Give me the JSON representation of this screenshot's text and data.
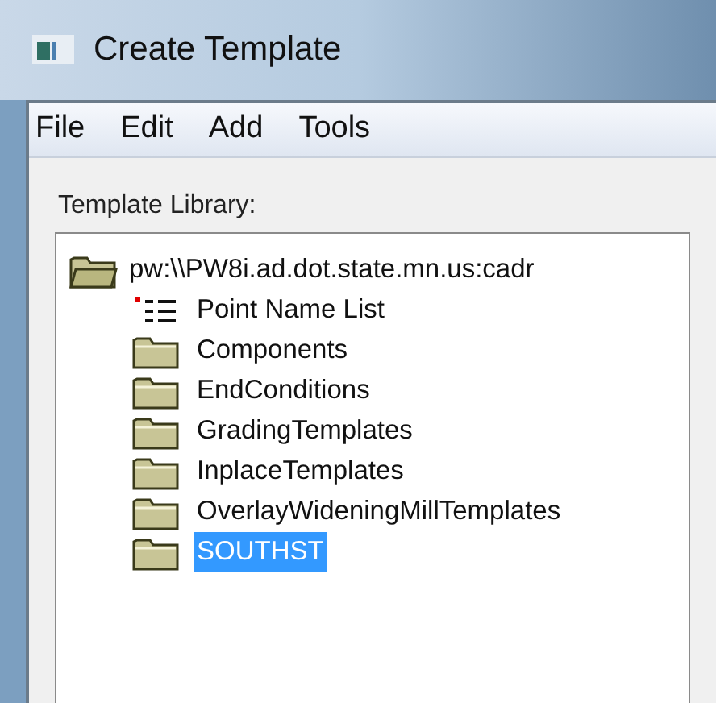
{
  "window": {
    "title": "Create Template"
  },
  "menu": [
    "File",
    "Edit",
    "Add",
    "Tools"
  ],
  "library_label": "Template Library:",
  "tree": {
    "label": "pw:\\\\PW8i.ad.dot.state.mn.us:cadr",
    "expanded": true,
    "selected": false,
    "children": [
      {
        "kind": "list",
        "label": "Point Name List",
        "selected": false
      },
      {
        "kind": "folder",
        "label": "Components",
        "selected": false
      },
      {
        "kind": "folder",
        "label": "EndConditions",
        "selected": false
      },
      {
        "kind": "folder",
        "label": "GradingTemplates",
        "selected": false
      },
      {
        "kind": "folder",
        "label": "InplaceTemplates",
        "selected": false
      },
      {
        "kind": "folder",
        "label": "OverlayWideningMillTemplates",
        "selected": false
      },
      {
        "kind": "folder",
        "label": "SOUTHST",
        "selected": true
      }
    ]
  }
}
